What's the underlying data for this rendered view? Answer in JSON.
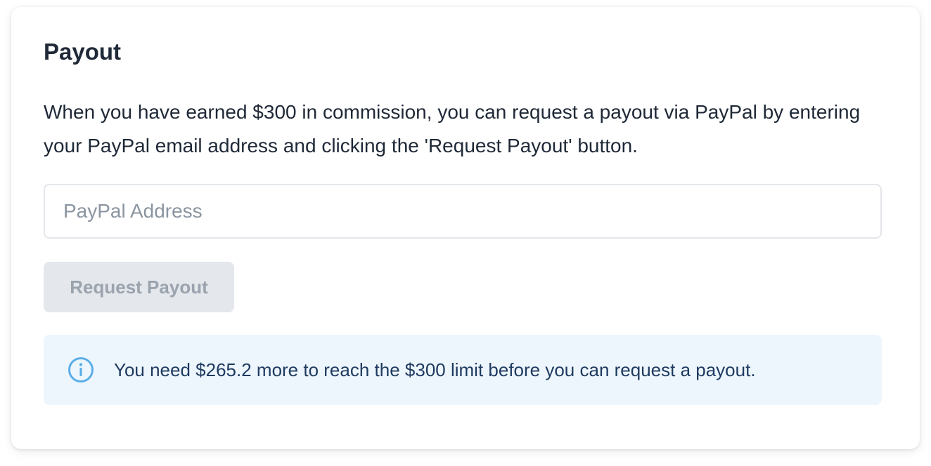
{
  "payout": {
    "title": "Payout",
    "description": "When you have earned $300 in commission, you can request a payout via PayPal by entering your PayPal email address and clicking the 'Request Payout' button.",
    "input": {
      "placeholder": "PayPal Address",
      "value": ""
    },
    "button_label": "Request Payout",
    "info_message": "You need $265.2 more to reach the $300 limit before you can request a payout.",
    "info_icon": "info-circle-icon"
  },
  "colors": {
    "title_text": "#1f2937",
    "button_disabled_bg": "#e4e7eb",
    "button_disabled_text": "#9aa3ae",
    "info_bg": "#eef6fd",
    "info_icon": "#5aaee8",
    "info_text": "#1e3a5f"
  }
}
